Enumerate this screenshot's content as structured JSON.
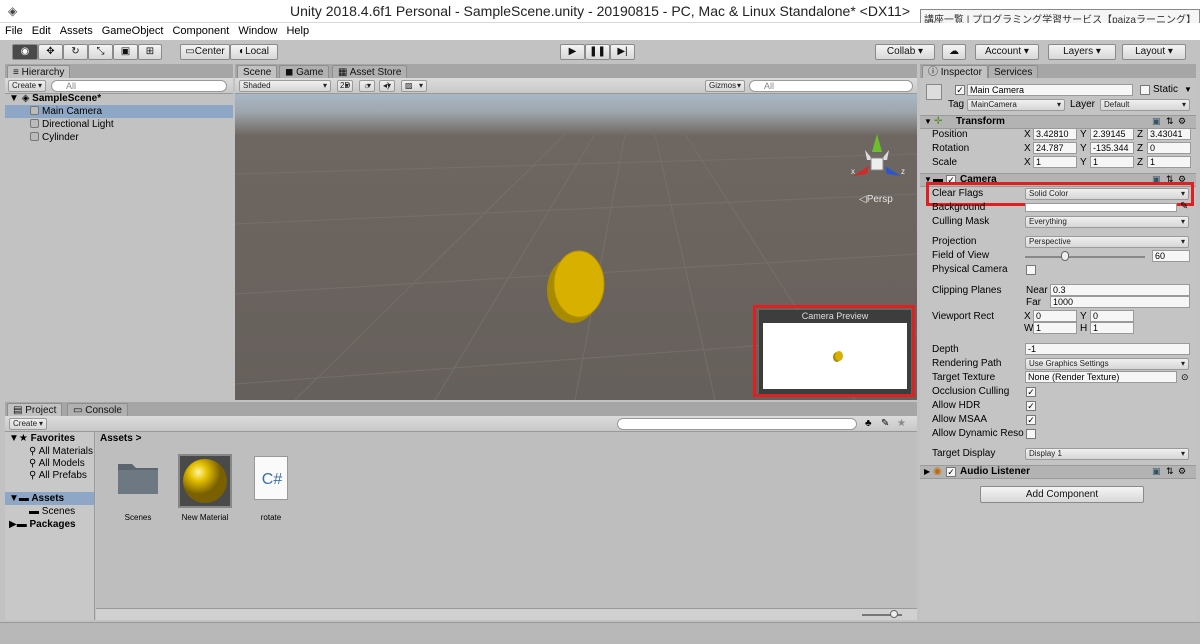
{
  "window": {
    "title": "Unity 2018.4.6f1 Personal - SampleScene.unity - 20190815 - PC, Mac & Linux Standalone* <DX11>",
    "tooltip": "講座一覧 | プログラミング学習サービス【paizaラーニング】"
  },
  "menu": [
    "File",
    "Edit",
    "Assets",
    "GameObject",
    "Component",
    "Window",
    "Help"
  ],
  "toolbar": {
    "center": "Center",
    "local": "Local",
    "collab": "Collab ▾",
    "account": "Account",
    "layers": "Layers",
    "layout": "Layout"
  },
  "hierarchy": {
    "tab": "Hierarchy",
    "create": "Create",
    "search": "All",
    "scene": "SampleScene*",
    "items": [
      "Main Camera",
      "Directional Light",
      "Cylinder"
    ]
  },
  "scene": {
    "tabs": [
      "Scene",
      "Game",
      "Asset Store"
    ],
    "shading": "Shaded",
    "mode2d": "2D",
    "gizmos": "Gizmos",
    "search": "All",
    "persp": "Persp",
    "axis_x": "x",
    "axis_z": "z",
    "preview_title": "Camera Preview"
  },
  "project": {
    "tabs": [
      "Project",
      "Console"
    ],
    "create": "Create",
    "favorites": "Favorites",
    "fav_items": [
      "All Materials",
      "All Models",
      "All Prefabs"
    ],
    "assets": "Assets",
    "asset_sub": [
      "Scenes"
    ],
    "packages": "Packages",
    "breadcrumb": "Assets",
    "breadcrumb_sep": ">",
    "files": [
      "Scenes",
      "New Material",
      "rotate"
    ],
    "cs_label": "C#"
  },
  "inspector": {
    "tabs": [
      "Inspector",
      "Services"
    ],
    "object_name": "Main Camera",
    "static": "Static",
    "tag_label": "Tag",
    "tag": "MainCamera",
    "layer_label": "Layer",
    "layer": "Default",
    "transform": {
      "title": "Transform",
      "rows": [
        {
          "label": "Position",
          "x": "3.42810",
          "y": "2.39145",
          "z": "3.43041"
        },
        {
          "label": "Rotation",
          "x": "24.787",
          "y": "-135.344",
          "z": "0"
        },
        {
          "label": "Scale",
          "x": "1",
          "y": "1",
          "z": "1"
        }
      ]
    },
    "camera": {
      "title": "Camera",
      "clear_flags_label": "Clear Flags",
      "clear_flags": "Solid Color",
      "background_label": "Background",
      "culling_mask_label": "Culling Mask",
      "culling_mask": "Everything",
      "projection_label": "Projection",
      "projection": "Perspective",
      "fov_label": "Field of View",
      "fov": "60",
      "fov_fraction": 0.33,
      "physical_label": "Physical Camera",
      "clipping_label": "Clipping Planes",
      "near_label": "Near",
      "near": "0.3",
      "far_label": "Far",
      "far": "1000",
      "viewport_label": "Viewport Rect",
      "vx": "0",
      "vy": "0",
      "vw": "1",
      "vh": "1",
      "depth_label": "Depth",
      "depth": "-1",
      "rendering_label": "Rendering Path",
      "rendering": "Use Graphics Settings",
      "target_texture_label": "Target Texture",
      "target_texture": "None (Render Texture)",
      "occlusion_label": "Occlusion Culling",
      "hdr_label": "Allow HDR",
      "msaa_label": "Allow MSAA",
      "dynres_label": "Allow Dynamic Resolu",
      "target_display_label": "Target Display",
      "target_display": "Display 1"
    },
    "audio_title": "Audio Listener",
    "add_component": "Add Component"
  },
  "colors": {
    "highlight": "#e02020",
    "coin": "#d8b000"
  }
}
